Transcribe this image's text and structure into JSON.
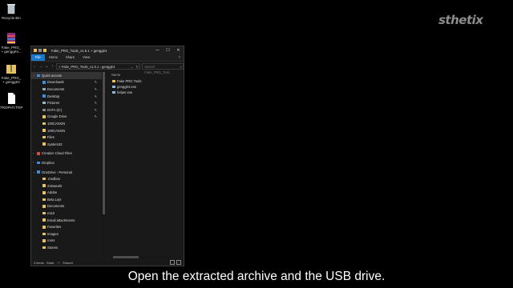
{
  "desktop": {
    "icons": [
      {
        "label": "Recycle Bin",
        "icon": "recycle-bin-icon"
      },
      {
        "label": "Fake_PRG_ + genggé4...",
        "icon": "winrar-archive-icon"
      },
      {
        "label": "Fake_PRG_ + genggé4",
        "icon": "folder-zip-icon"
      },
      {
        "label": "TROPHY.TRP",
        "icon": "file-icon"
      }
    ]
  },
  "logo": "sthetix",
  "caption": "Open the extracted archive and the USB drive.",
  "window": {
    "title": "Fake_PRG_Tools_v1.5.1 + genggé4",
    "controls": {
      "minimize": "—",
      "maximize": "☐",
      "close": "✕"
    },
    "ribbon_tabs": [
      "File",
      "Home",
      "Share",
      "View"
    ],
    "help": "?",
    "address": "« Fake_PRG_Tools_v1.5.1 › genggé4",
    "search_placeholder": "Search Fake_PRG_Tool...",
    "nav_pane": [
      {
        "label": "Quick access",
        "icon": "star-icon",
        "color": "#3b8ee0",
        "level": 0,
        "pinned": false
      },
      {
        "label": "Downloads",
        "icon": "downloads-icon",
        "color": "#3b8ee0",
        "level": 1,
        "pinned": true
      },
      {
        "label": "Documents",
        "icon": "documents-icon",
        "color": "#9aa7b5",
        "level": 1,
        "pinned": true
      },
      {
        "label": "Desktop",
        "icon": "desktop-icon",
        "color": "#3b8ee0",
        "level": 1,
        "pinned": true
      },
      {
        "label": "Pictures",
        "icon": "pictures-icon",
        "color": "#9ab6cf",
        "level": 1,
        "pinned": true
      },
      {
        "label": "DATA (D:)",
        "icon": "drive-icon",
        "color": "#8a8a8a",
        "level": 1,
        "pinned": true
      },
      {
        "label": "Google Drive",
        "icon": "folder-icon",
        "color": "#e8c25b",
        "level": 1,
        "pinned": true
      },
      {
        "label": "100CANON",
        "icon": "folder-icon",
        "color": "#e8c25b",
        "level": 1,
        "pinned": false
      },
      {
        "label": "100CANON",
        "icon": "folder-icon",
        "color": "#e8c25b",
        "level": 1,
        "pinned": false
      },
      {
        "label": "Files",
        "icon": "folder-icon",
        "color": "#e8c25b",
        "level": 1,
        "pinned": false
      },
      {
        "label": "System32",
        "icon": "folder-icon",
        "color": "#e8c25b",
        "level": 1,
        "pinned": false
      },
      {
        "label": "",
        "icon": "",
        "color": "",
        "level": 0,
        "pinned": false
      },
      {
        "label": "Creative Cloud Files",
        "icon": "creative-cloud-icon",
        "color": "#d94b4b",
        "level": 0,
        "pinned": false
      },
      {
        "label": "",
        "icon": "",
        "color": "",
        "level": 0,
        "pinned": false
      },
      {
        "label": "Dropbox",
        "icon": "dropbox-icon",
        "color": "#3b8ee0",
        "level": 0,
        "pinned": false
      },
      {
        "label": "",
        "icon": "",
        "color": "",
        "level": 0,
        "pinned": false
      },
      {
        "label": "OneDrive - Personal",
        "icon": "onedrive-icon",
        "color": "#3b8ee0",
        "level": 0,
        "pinned": false
      },
      {
        "label": ".medbox",
        "icon": "folder-icon",
        "color": "#e8c25b",
        "level": 1,
        "pinned": false
      },
      {
        "label": "232weaht",
        "icon": "folder-icon",
        "color": "#e8c25b",
        "level": 1,
        "pinned": false
      },
      {
        "label": "Adobe",
        "icon": "folder-icon",
        "color": "#e8c25b",
        "level": 1,
        "pinned": false
      },
      {
        "label": "Beta Lejs",
        "icon": "folder-icon",
        "color": "#e8c25b",
        "level": 1,
        "pinned": false
      },
      {
        "label": "Documents",
        "icon": "folder-icon",
        "color": "#e8c25b",
        "level": 1,
        "pinned": false
      },
      {
        "label": "e110",
        "icon": "folder-icon",
        "color": "#e8c25b",
        "level": 1,
        "pinned": false
      },
      {
        "label": "Email attachments",
        "icon": "folder-icon",
        "color": "#e8c25b",
        "level": 1,
        "pinned": false
      },
      {
        "label": "Favorites",
        "icon": "folder-icon",
        "color": "#e8c25b",
        "level": 1,
        "pinned": false
      },
      {
        "label": "Images",
        "icon": "folder-icon",
        "color": "#e8c25b",
        "level": 1,
        "pinned": false
      },
      {
        "label": "roms",
        "icon": "folder-icon",
        "color": "#e8c25b",
        "level": 1,
        "pinned": false
      },
      {
        "label": "Stories",
        "icon": "folder-icon",
        "color": "#e8c25b",
        "level": 1,
        "pinned": false
      }
    ],
    "column_header": "Name",
    "files": [
      {
        "name": "Fake PRG Tools",
        "icon": "folder-icon",
        "color": "#e8c25b"
      },
      {
        "name": "genggé4.exe",
        "icon": "exe-icon",
        "color": "#8fb4d9"
      },
      {
        "name": "helper.exe",
        "icon": "exe-icon",
        "color": "#8fb4d9"
      }
    ],
    "status": {
      "items": "3 items",
      "state": "State:",
      "share": "Shared"
    }
  },
  "colors": {
    "accent": "#1979ca",
    "window_bg": "#191919",
    "desktop_bg": "#000000"
  }
}
